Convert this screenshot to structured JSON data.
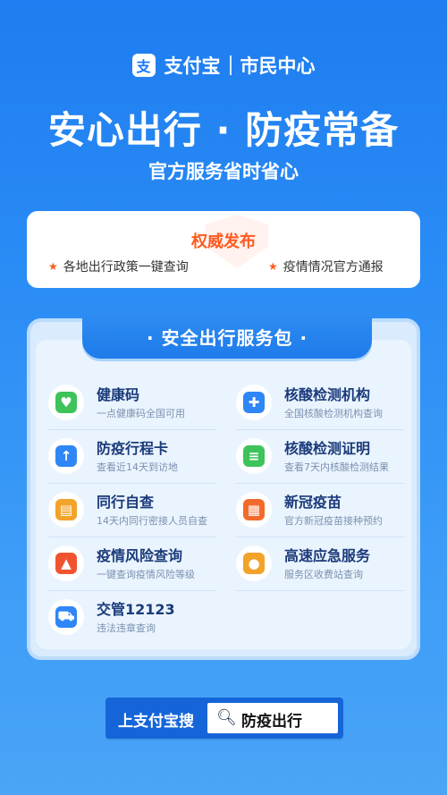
{
  "brand": {
    "logo_glyph": "支",
    "name": "支付宝",
    "section": "市民中心"
  },
  "headline": "安心出行 · 防疫常备",
  "subheadline": "官方服务省时省心",
  "authority": {
    "title": "权威发布",
    "items": [
      "各地出行政策一键查询",
      "疫情情况官方通报"
    ]
  },
  "package": {
    "title": "· 安全出行服务包 ·",
    "services": [
      {
        "title": "健康码",
        "desc": "一点健康码全国可用",
        "icon": "health-code-icon",
        "color": "#3ec35b",
        "glyph": "♥"
      },
      {
        "title": "核酸检测机构",
        "desc": "全国核酸检测机构查询",
        "icon": "hospital-icon",
        "color": "#2f86f6",
        "glyph": "✚"
      },
      {
        "title": "防疫行程卡",
        "desc": "查看近14天到访地",
        "icon": "itinerary-card-icon",
        "color": "#2f86f6",
        "glyph": "↑"
      },
      {
        "title": "核酸检测证明",
        "desc": "查看7天内核酸检测结果",
        "icon": "test-certificate-icon",
        "color": "#3ec35b",
        "glyph": "≡"
      },
      {
        "title": "同行自查",
        "desc": "14天内同行密接人员自查",
        "icon": "train-icon",
        "color": "#f2a329",
        "glyph": "▤"
      },
      {
        "title": "新冠疫苗",
        "desc": "官方新冠疫苗接种预约",
        "icon": "calendar-icon",
        "color": "#f26a2b",
        "glyph": "▦"
      },
      {
        "title": "疫情风险查询",
        "desc": "一键查询疫情风险等级",
        "icon": "alarm-light-icon",
        "color": "#f0542f",
        "glyph": "▲"
      },
      {
        "title": "高速应急服务",
        "desc": "服务区收费站查询",
        "icon": "location-pin-icon",
        "color": "#f2a329",
        "glyph": "●"
      },
      {
        "title": "交管12123",
        "desc": "违法违章查询",
        "icon": "car-search-icon",
        "color": "#2f86f6",
        "glyph": "⛟"
      }
    ]
  },
  "search": {
    "label": "上支付宝搜",
    "query": "防疫出行",
    "icon": "search-icon"
  }
}
